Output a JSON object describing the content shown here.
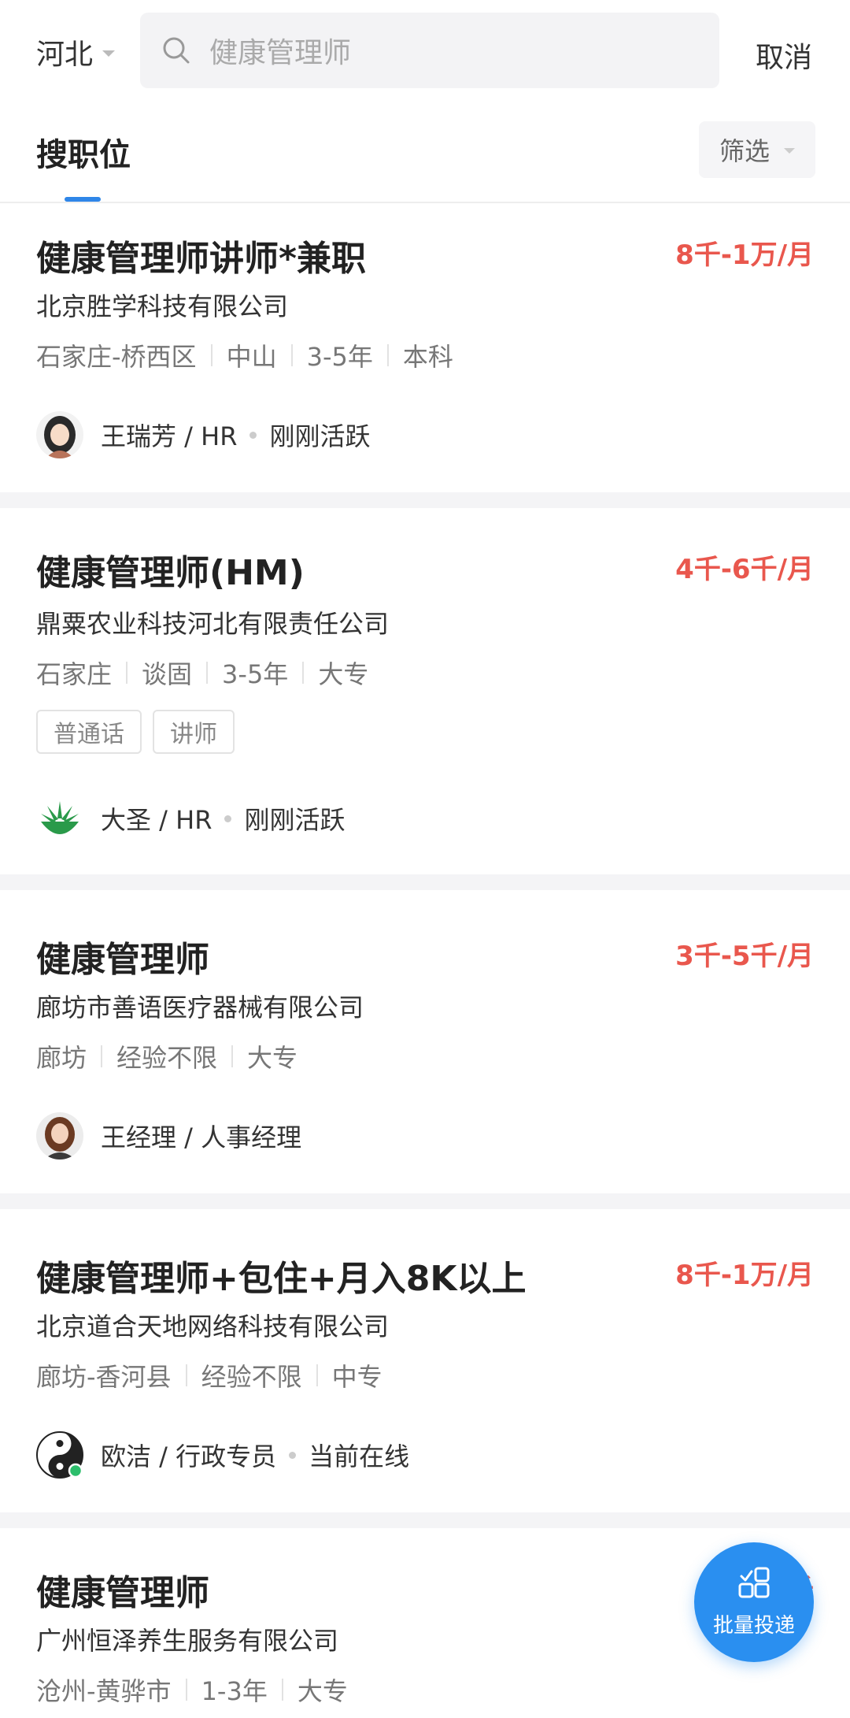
{
  "header": {
    "city": "河北",
    "search_text": "健康管理师",
    "cancel_label": "取消"
  },
  "tabs": {
    "active_label": "搜职位",
    "filter_label": "筛选"
  },
  "jobs": [
    {
      "title": "健康管理师讲师*兼职",
      "salary": "8千-1万/月",
      "company": "北京胜学科技有限公司",
      "meta": [
        "石家庄-桥西区",
        "中山",
        "3-5年",
        "本科"
      ],
      "tags": [],
      "recruiter": "王瑞芳 / HR",
      "status": "刚刚活跃"
    },
    {
      "title": "健康管理师(HM)",
      "salary": "4千-6千/月",
      "company": "鼎粟农业科技河北有限责任公司",
      "meta": [
        "石家庄",
        "谈固",
        "3-5年",
        "大专"
      ],
      "tags": [
        "普通话",
        "讲师"
      ],
      "recruiter": "大圣 / HR",
      "status": "刚刚活跃"
    },
    {
      "title": "健康管理师",
      "salary": "3千-5千/月",
      "company": "廊坊市善语医疗器械有限公司",
      "meta": [
        "廊坊",
        "经验不限",
        "大专"
      ],
      "tags": [],
      "recruiter": "王经理 / 人事经理",
      "status": ""
    },
    {
      "title": "健康管理师+包住+月入8K以上",
      "salary": "8千-1万/月",
      "company": "北京道合天地网络科技有限公司",
      "meta": [
        "廊坊-香河县",
        "经验不限",
        "中专"
      ],
      "tags": [],
      "recruiter": "欧洁 / 行政专员",
      "status": "当前在线"
    },
    {
      "title": "健康管理师",
      "salary": "5千",
      "company": "广州恒泽养生服务有限公司",
      "meta": [
        "沧州-黄骅市",
        "1-3年",
        "大专"
      ],
      "tags": [],
      "recruiter": "",
      "status": ""
    }
  ],
  "fab": {
    "label": "批量投递",
    "icon": "batch-apply-icon"
  },
  "colors": {
    "salary": "#e9574d",
    "accent": "#2f86e8",
    "fab": "#2a8ff0"
  }
}
